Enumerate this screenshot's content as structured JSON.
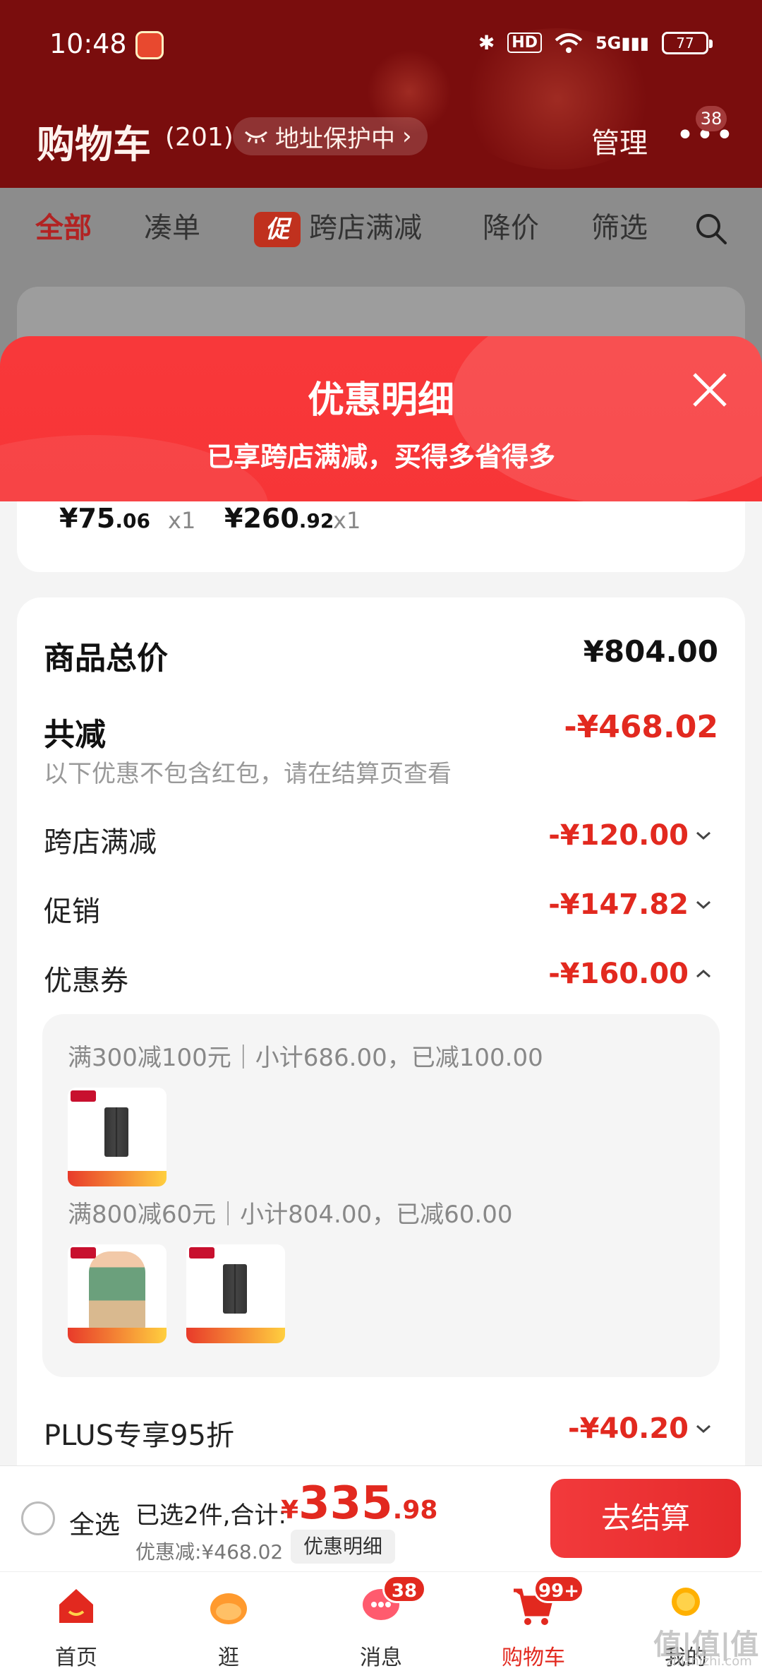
{
  "status": {
    "time": "10:48",
    "hd": "HD",
    "signal": "5G",
    "battery": "77"
  },
  "header": {
    "title": "购物车",
    "count": "(201)",
    "address_pill": "地址保护中",
    "manage": "管理",
    "more_badge": "38"
  },
  "filter_tabs": {
    "all": "全部",
    "bundle": "凑单",
    "promo_mark": "促",
    "cross_store": "跨店满减",
    "price_drop": "降价",
    "filter": "筛选"
  },
  "sheet": {
    "title": "优惠明细",
    "subtitle": "已享跨店满减，买得多省得多",
    "items": [
      {
        "price_int": "¥75",
        "price_dec": ".06",
        "qty": "x1"
      },
      {
        "price_int": "¥260",
        "price_dec": ".92",
        "qty": "x1"
      }
    ],
    "total_label": "商品总价",
    "total_value": "¥804.00",
    "reduce_label": "共减",
    "reduce_value": "-¥468.02",
    "reduce_note": "以下优惠不包含红包，请在结算页查看",
    "rows": [
      {
        "label": "跨店满减",
        "value": "-¥120.00"
      },
      {
        "label": "促销",
        "value": "-¥147.82"
      },
      {
        "label": "优惠券",
        "value": "-¥160.00"
      }
    ],
    "coupons": [
      {
        "text": "满300减100元｜小计686.00，已减100.00"
      },
      {
        "text": "满800减60元｜小计804.00，已减60.00"
      }
    ],
    "plus_label": "PLUS专享95折",
    "plus_value": "-¥40.20"
  },
  "checkout": {
    "select_all": "全选",
    "selected_info": "已选2件,合计:",
    "total_symbol": "¥",
    "total_int": "335",
    "total_dec": ".98",
    "discount_info": "优惠减:¥468.02",
    "detail_chip": "优惠明细",
    "button": "去结算"
  },
  "tabbar": {
    "tabs": [
      {
        "label": "首页"
      },
      {
        "label": "逛"
      },
      {
        "label": "消息",
        "badge": "38"
      },
      {
        "label": "购物车",
        "badge": "99+"
      },
      {
        "label": "我的"
      }
    ]
  },
  "watermark": {
    "main": "值|值|值",
    "sub": "zhizhizhi.com"
  },
  "colors": {
    "accent": "#e2291f",
    "header_bg": "#7a0d0d",
    "sheet_header": "#f8383a"
  }
}
